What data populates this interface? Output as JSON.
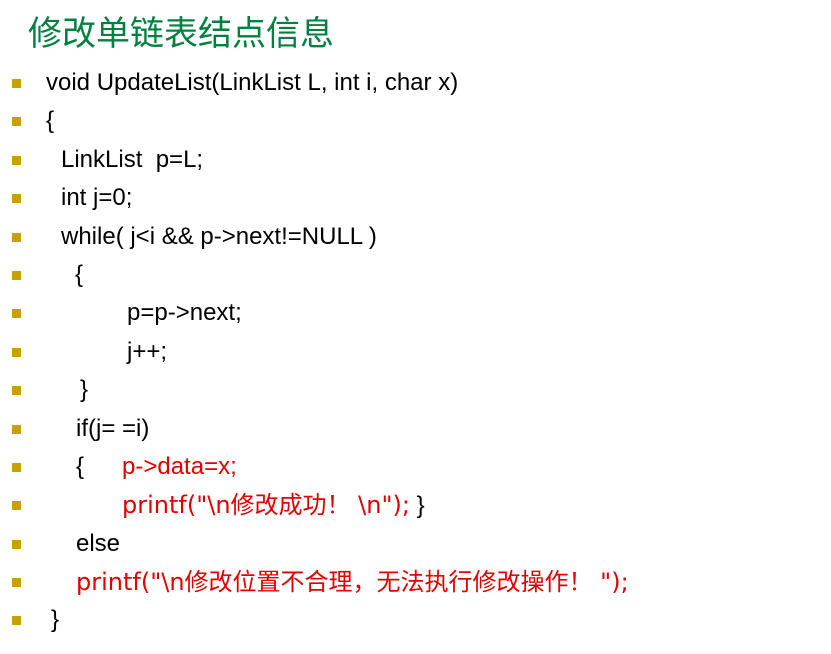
{
  "slide": {
    "title": "修改单链表结点信息"
  },
  "code": {
    "line_01": "void UpdateList(LinkList L, int i, char x)",
    "line_02": "{",
    "line_03": "LinkList  p=L;",
    "line_04": "int j=0;",
    "line_05": "while( j<i && p->next!=NULL )",
    "line_06": "{",
    "line_07": "p=p->next;",
    "line_08": "j++;",
    "line_09": "}",
    "line_10": "if(j= =i)",
    "line_11a": "{",
    "line_11b": "p->data=x;",
    "line_12a": "printf(\"\\n修改成功！ \\n\");",
    "line_12b": " }",
    "line_13": "else",
    "line_14": "printf(\"\\n修改位置不合理，无法执行修改操作！ \");",
    "line_15": "}"
  },
  "colors": {
    "title": "#008040",
    "bullet": "#c8a000",
    "code_default": "#000000",
    "code_highlight": "#e00000"
  }
}
